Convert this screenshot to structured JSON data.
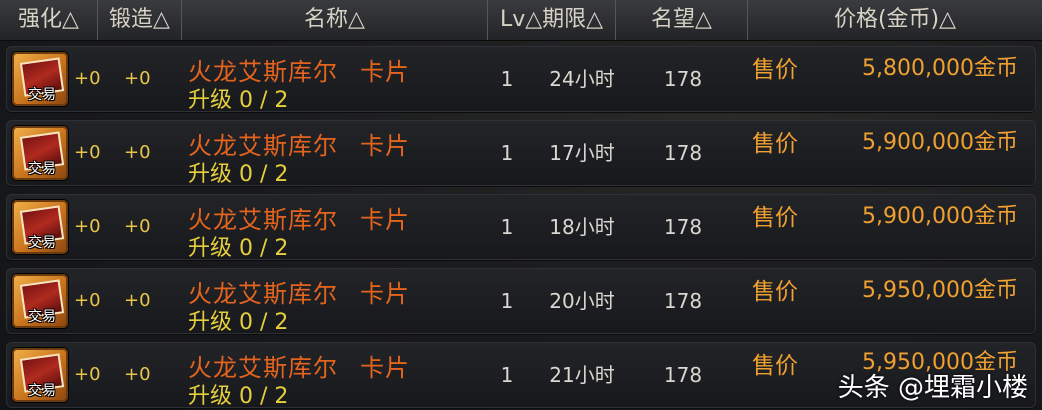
{
  "header": {
    "enhance": "强化△",
    "forge": "锻造△",
    "name": "名称△",
    "lv_period": "Lv△期限△",
    "fame": "名望△",
    "price": "价格(金币)△"
  },
  "rows": [
    {
      "enhance": "+0",
      "forge": "+0",
      "name": "火龙艾斯库尔",
      "name_suffix": "卡片",
      "upgrade": "升级 0 / 2",
      "trade_label": "交易",
      "lv": "1",
      "period": "24小时",
      "fame": "178",
      "sale_label": "售价",
      "price": "5,800,000金币"
    },
    {
      "enhance": "+0",
      "forge": "+0",
      "name": "火龙艾斯库尔",
      "name_suffix": "卡片",
      "upgrade": "升级 0 / 2",
      "trade_label": "交易",
      "lv": "1",
      "period": "17小时",
      "fame": "178",
      "sale_label": "售价",
      "price": "5,900,000金币"
    },
    {
      "enhance": "+0",
      "forge": "+0",
      "name": "火龙艾斯库尔",
      "name_suffix": "卡片",
      "upgrade": "升级 0 / 2",
      "trade_label": "交易",
      "lv": "1",
      "period": "18小时",
      "fame": "178",
      "sale_label": "售价",
      "price": "5,900,000金币"
    },
    {
      "enhance": "+0",
      "forge": "+0",
      "name": "火龙艾斯库尔",
      "name_suffix": "卡片",
      "upgrade": "升级 0 / 2",
      "trade_label": "交易",
      "lv": "1",
      "period": "20小时",
      "fame": "178",
      "sale_label": "售价",
      "price": "5,950,000金币"
    },
    {
      "enhance": "+0",
      "forge": "+0",
      "name": "火龙艾斯库尔",
      "name_suffix": "卡片",
      "upgrade": "升级 0 / 2",
      "trade_label": "交易",
      "lv": "1",
      "period": "21小时",
      "fame": "178",
      "sale_label": "售价",
      "price": "5,950,000金币"
    }
  ],
  "watermark": "头条 @埋霜小楼",
  "colors": {
    "item_name": "#e4641e",
    "upgrade": "#e6cf3c",
    "price": "#f0a030",
    "plus_value": "#e9c64a"
  }
}
